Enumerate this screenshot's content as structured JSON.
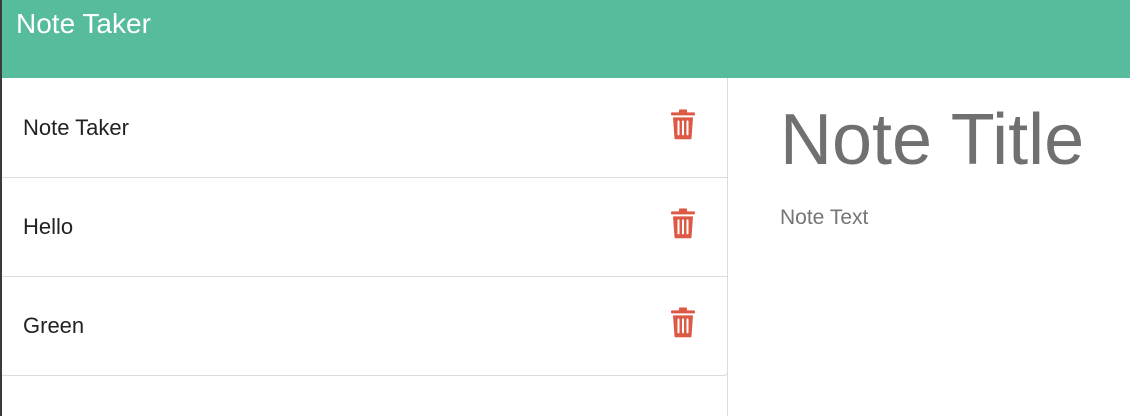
{
  "navbar": {
    "title": "Note Taker"
  },
  "notes": [
    {
      "title": "Note Taker",
      "icon": "trash-icon"
    },
    {
      "title": "Hello",
      "icon": "trash-icon"
    },
    {
      "title": "Green",
      "icon": "trash-icon"
    }
  ],
  "editor": {
    "title_placeholder": "Note Title",
    "text_placeholder": "Note Text"
  },
  "colors": {
    "navbar": "#57bb9e",
    "trash": "#dc5a45",
    "placeholder": "#707070"
  }
}
